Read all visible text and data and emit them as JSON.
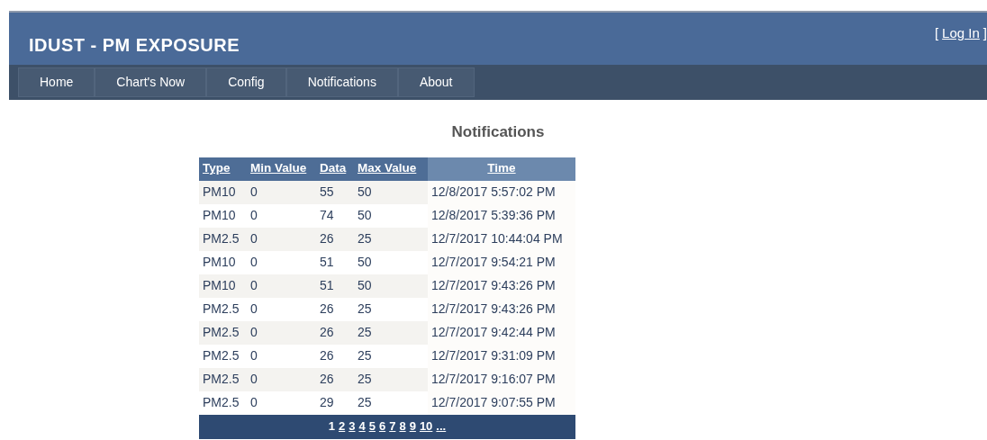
{
  "header": {
    "title": "IDUST - PM EXPOSURE",
    "login_open": "[",
    "login_link": "Log In",
    "login_close": "]"
  },
  "nav": [
    {
      "label": "Home",
      "selected": false
    },
    {
      "label": "Chart's Now",
      "selected": false
    },
    {
      "label": "Config",
      "selected": false
    },
    {
      "label": "Notifications",
      "selected": false
    },
    {
      "label": "About",
      "selected": false
    }
  ],
  "page_title": "Notifications",
  "table": {
    "columns": [
      {
        "label": "Type",
        "sorted": false
      },
      {
        "label": "Min Value",
        "sorted": false
      },
      {
        "label": "Data",
        "sorted": false
      },
      {
        "label": "Max Value",
        "sorted": false
      },
      {
        "label": "Time",
        "sorted": true
      }
    ],
    "rows": [
      [
        "PM10",
        "0",
        "55",
        "50",
        "12/8/2017 5:57:02 PM"
      ],
      [
        "PM10",
        "0",
        "74",
        "50",
        "12/8/2017 5:39:36 PM"
      ],
      [
        "PM2.5",
        "0",
        "26",
        "25",
        "12/7/2017 10:44:04 PM"
      ],
      [
        "PM10",
        "0",
        "51",
        "50",
        "12/7/2017 9:54:21 PM"
      ],
      [
        "PM10",
        "0",
        "51",
        "50",
        "12/7/2017 9:43:26 PM"
      ],
      [
        "PM2.5",
        "0",
        "26",
        "25",
        "12/7/2017 9:43:26 PM"
      ],
      [
        "PM2.5",
        "0",
        "26",
        "25",
        "12/7/2017 9:42:44 PM"
      ],
      [
        "PM2.5",
        "0",
        "26",
        "25",
        "12/7/2017 9:31:09 PM"
      ],
      [
        "PM2.5",
        "0",
        "26",
        "25",
        "12/7/2017 9:16:07 PM"
      ],
      [
        "PM2.5",
        "0",
        "29",
        "25",
        "12/7/2017 9:07:55 PM"
      ]
    ]
  },
  "pager": [
    {
      "label": "1",
      "selected": true
    },
    {
      "label": "2",
      "selected": false
    },
    {
      "label": "3",
      "selected": false
    },
    {
      "label": "4",
      "selected": false
    },
    {
      "label": "5",
      "selected": false
    },
    {
      "label": "6",
      "selected": false
    },
    {
      "label": "7",
      "selected": false
    },
    {
      "label": "8",
      "selected": false
    },
    {
      "label": "9",
      "selected": false
    },
    {
      "label": "10",
      "selected": false
    },
    {
      "label": "...",
      "selected": false
    }
  ]
}
